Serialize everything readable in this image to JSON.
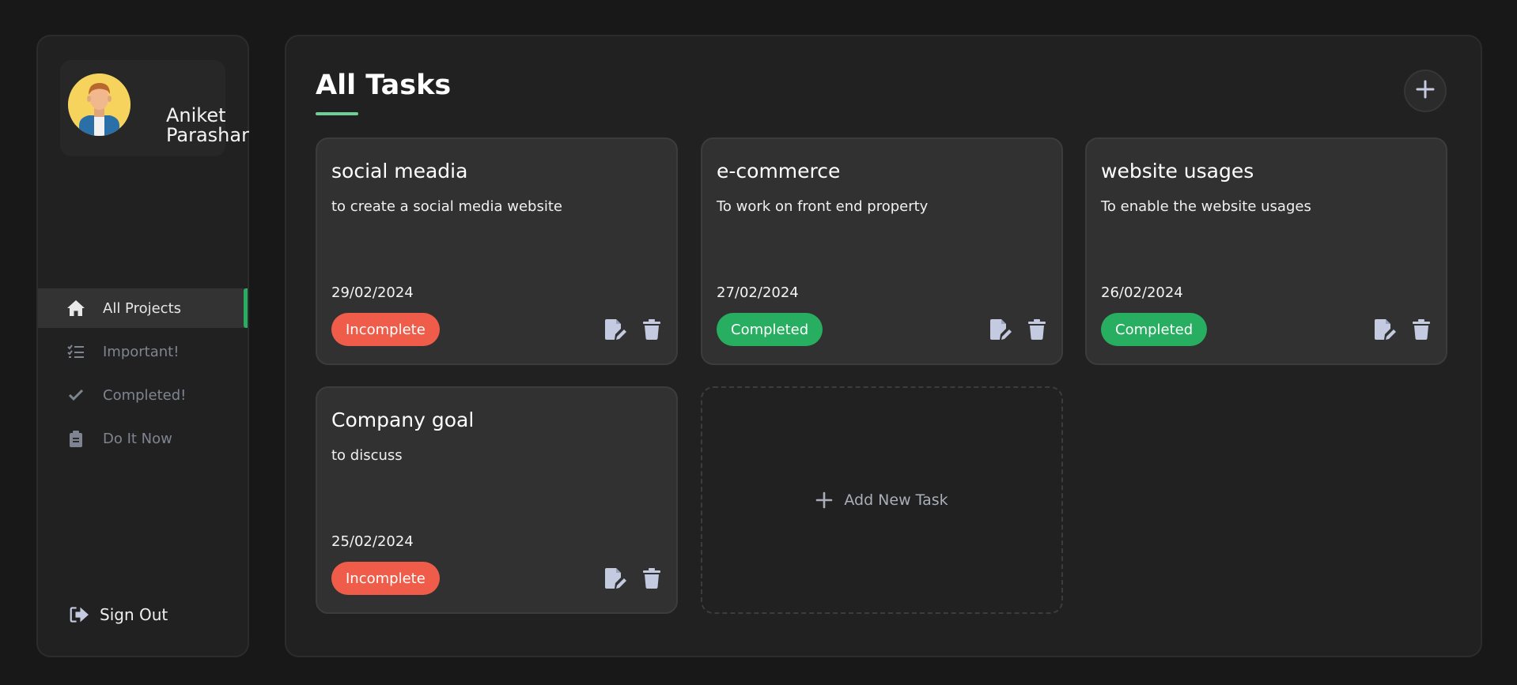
{
  "user": {
    "name": "Aniket Parashar"
  },
  "nav": {
    "items": [
      {
        "label": "All Projects",
        "icon": "home-icon",
        "active": true
      },
      {
        "label": "Important!",
        "icon": "list-check-icon",
        "active": false
      },
      {
        "label": "Completed!",
        "icon": "check-icon",
        "active": false
      },
      {
        "label": "Do It Now",
        "icon": "clipboard-icon",
        "active": false
      }
    ],
    "signout_label": "Sign Out"
  },
  "main": {
    "title": "All Tasks",
    "add_new_task_label": "Add New Task"
  },
  "tasks": [
    {
      "title": "social meadia",
      "description": "to create a social media website",
      "date": "29/02/2024",
      "status": "Incomplete"
    },
    {
      "title": "e-commerce",
      "description": "To work on front end property",
      "date": "27/02/2024",
      "status": "Completed"
    },
    {
      "title": "website usages",
      "description": "To enable the website usages",
      "date": "26/02/2024",
      "status": "Completed"
    },
    {
      "title": "Company goal",
      "description": "to discuss",
      "date": "25/02/2024",
      "status": "Incomplete"
    }
  ],
  "colors": {
    "accent": "#27ae60",
    "incomplete": "#ef5d4a",
    "completed": "#27ae60",
    "underline": "#6fcf97"
  }
}
